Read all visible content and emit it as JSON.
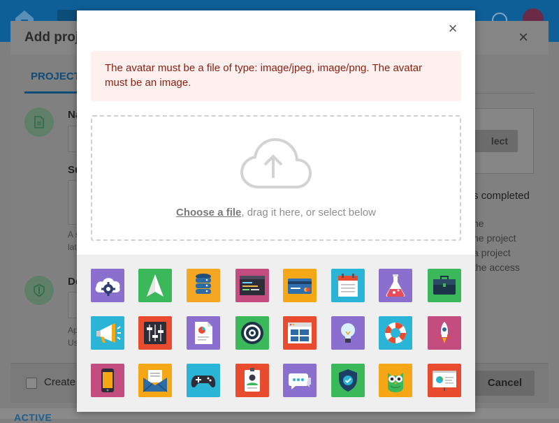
{
  "background": {
    "modal_title": "Add proje",
    "close_glyph": "×",
    "tab_label": "PROJECT",
    "labels": [
      "Na",
      "Su",
      "De"
    ],
    "field_hint_1": "A s",
    "field_hint_2": "lat",
    "field_hint_3": "Ap",
    "field_hint_4": "Us",
    "select_label": "lect",
    "completed_text": "s completed",
    "description_lines": [
      "he",
      "he project",
      "a project",
      "the access"
    ],
    "create_label": "Create",
    "cancel_label": "Cancel",
    "active_label": "ACTIVE"
  },
  "modal": {
    "close_glyph": "×",
    "error_message": "The avatar must be a file of type: image/jpeg, image/png. The avatar must be an image.",
    "dropzone": {
      "choose_link": "Choose a file",
      "rest_text": ", drag it here, or select below"
    },
    "avatars": [
      {
        "name": "cloud-gear",
        "color": "#8a6fcf"
      },
      {
        "name": "paper-plane",
        "color": "#3bb85a"
      },
      {
        "name": "database",
        "color": "#f5a623"
      },
      {
        "name": "terminal-window",
        "color": "#c24d7e"
      },
      {
        "name": "credit-card",
        "color": "#f6a716"
      },
      {
        "name": "calendar",
        "color": "#2ab4d6"
      },
      {
        "name": "flask",
        "color": "#8a6fcf"
      },
      {
        "name": "briefcase",
        "color": "#3bb85a"
      },
      {
        "name": "megaphone",
        "color": "#2ab4d6"
      },
      {
        "name": "equalizer",
        "color": "#e84b2e"
      },
      {
        "name": "document-chart",
        "color": "#8a6fcf"
      },
      {
        "name": "target",
        "color": "#3bb85a"
      },
      {
        "name": "browser-window",
        "color": "#e84b2e"
      },
      {
        "name": "lightbulb",
        "color": "#8a6fcf"
      },
      {
        "name": "lifebuoy",
        "color": "#2ab4d6"
      },
      {
        "name": "rocket",
        "color": "#c24d7e"
      },
      {
        "name": "smartphone",
        "color": "#c24d7e"
      },
      {
        "name": "envelope",
        "color": "#f6a716"
      },
      {
        "name": "gamepad",
        "color": "#2ab4d6"
      },
      {
        "name": "id-badge",
        "color": "#e84b2e"
      },
      {
        "name": "chat-bubbles",
        "color": "#8a6fcf"
      },
      {
        "name": "shield-check",
        "color": "#3bb85a"
      },
      {
        "name": "owl",
        "color": "#f6a716"
      },
      {
        "name": "presentation",
        "color": "#e84b2e"
      }
    ]
  }
}
